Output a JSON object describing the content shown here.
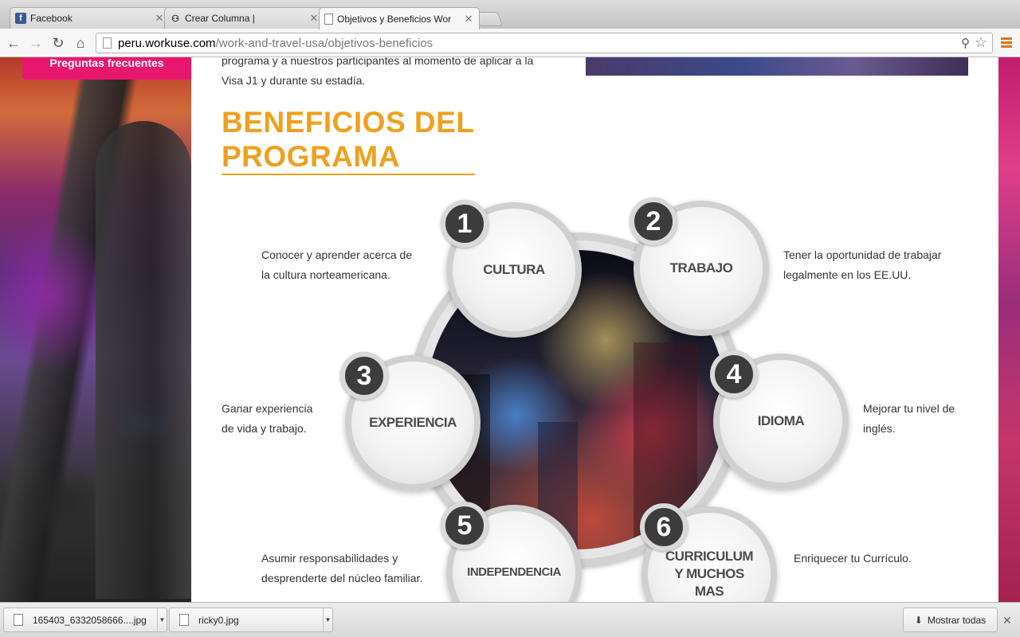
{
  "tabs": [
    {
      "title": "Facebook",
      "icon": "facebook-icon"
    },
    {
      "title": "Crear Columna |",
      "icon": "user-icon"
    },
    {
      "title": "Objetivos y Beneficios Wor",
      "icon": "page-icon",
      "active": true
    }
  ],
  "address": {
    "host": "peru.workuse.com",
    "path": "/work-and-travel-usa/objetivos-beneficios"
  },
  "sidebar": {
    "faq_label": "Preguntas frecuentes"
  },
  "page": {
    "intro_line1": "programa y a nuestros participantes al momento de aplicar a la",
    "intro_line2": "Visa J1 y durante su estadía.",
    "title_line1": "BENEFICIOS DEL",
    "title_line2": "PROGRAMA",
    "accent_color": "#f0a01e"
  },
  "benefits": [
    {
      "number": "1",
      "label": "CULTURA",
      "desc_line1": "Conocer y aprender acerca de",
      "desc_line2": "la cultura norteamericana."
    },
    {
      "number": "2",
      "label": "TRABAJO",
      "desc_line1": "Tener la oportunidad de trabajar",
      "desc_line2": "legalmente en los EE.UU."
    },
    {
      "number": "3",
      "label": "EXPERIENCIA",
      "desc_line1": "Ganar experiencia",
      "desc_line2": "de vida y trabajo."
    },
    {
      "number": "4",
      "label": "IDIOMA",
      "desc_line1": "Mejorar tu nivel de",
      "desc_line2": "inglés."
    },
    {
      "number": "5",
      "label": "INDEPENDENCIA",
      "desc_line1": "Asumir responsabilidades y",
      "desc_line2": "desprenderte del núcleo familiar."
    },
    {
      "number": "6",
      "label_line1": "CURRICULUM",
      "label_line2": "Y MUCHOS",
      "label_line3": "MAS",
      "desc_line1": "Enriquecer tu Currículo."
    }
  ],
  "downloads": [
    {
      "name": "165403_6332058666....jpg"
    },
    {
      "name": "ricky0.jpg"
    }
  ],
  "download_bar": {
    "show_all": "Mostrar todas"
  }
}
